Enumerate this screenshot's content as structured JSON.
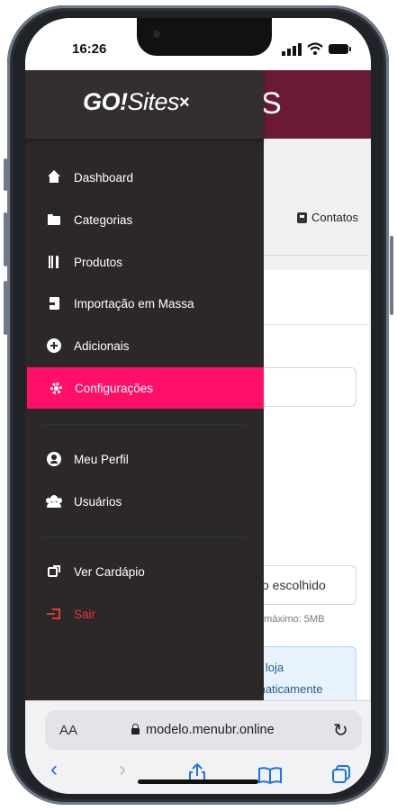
{
  "status_bar": {
    "time": "16:26"
  },
  "background_page": {
    "header_text": "S",
    "tab_partial": "s",
    "tab_contacts": "Contatos",
    "file_input_partial": "vo escolhido",
    "file_hint_partial": "o máximo: 5MB",
    "alert_line1": "a loja",
    "alert_line2": "maticamente"
  },
  "drawer": {
    "logo_go": "GO!",
    "logo_sites": "Sites",
    "logo_x": "×",
    "items": [
      {
        "label": "Dashboard",
        "icon": "home-icon"
      },
      {
        "label": "Categorias",
        "icon": "folder-icon"
      },
      {
        "label": "Produtos",
        "icon": "utensils-icon"
      },
      {
        "label": "Importação em Massa",
        "icon": "file-import-icon"
      },
      {
        "label": "Adicionais",
        "icon": "plus-circle-icon"
      },
      {
        "label": "Configurações",
        "icon": "gear-icon",
        "active": true
      },
      {
        "label": "Meu Perfil",
        "icon": "user-circle-icon"
      },
      {
        "label": "Usuários",
        "icon": "users-icon"
      },
      {
        "label": "Ver Cardápio",
        "icon": "external-link-icon"
      },
      {
        "label": "Sair",
        "icon": "sign-out-icon"
      }
    ],
    "active_color": "#ff0f68",
    "background_color": "#2c2828",
    "danger_color": "#e53935"
  },
  "browser": {
    "text_size_label": "AA",
    "url": "modelo.menubr.online",
    "reload_icon": "reload-icon",
    "toolbar": [
      "back-icon",
      "forward-icon",
      "share-icon",
      "bookmarks-icon",
      "tabs-icon"
    ],
    "accent_color": "#1a73e8"
  }
}
